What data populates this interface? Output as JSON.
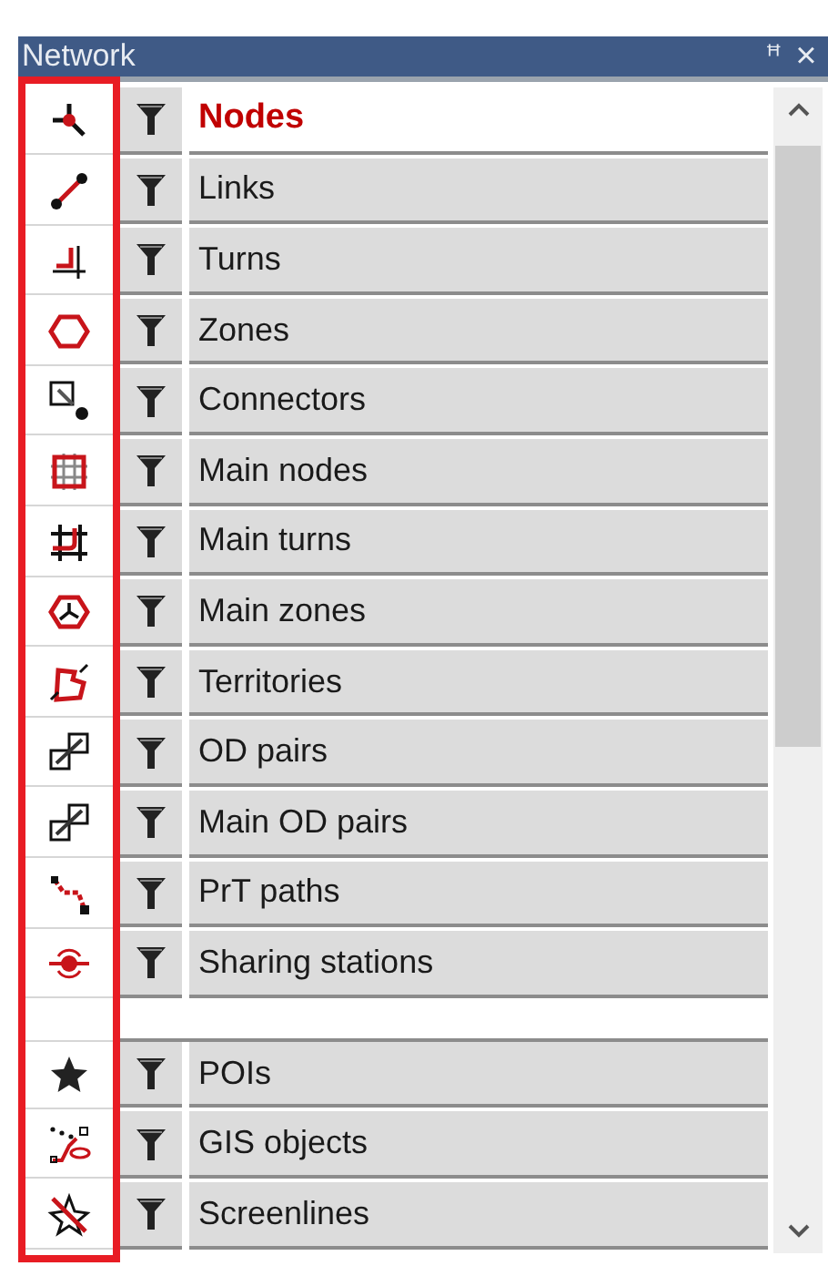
{
  "window": {
    "title": "Network",
    "pin": "ꟸ",
    "close": "×"
  },
  "items": [
    {
      "label": "Nodes",
      "selected": true,
      "kind": "item"
    },
    {
      "label": "Links",
      "selected": false,
      "kind": "item"
    },
    {
      "label": "Turns",
      "selected": false,
      "kind": "item"
    },
    {
      "label": "Zones",
      "selected": false,
      "kind": "item"
    },
    {
      "label": "Connectors",
      "selected": false,
      "kind": "item"
    },
    {
      "label": "Main nodes",
      "selected": false,
      "kind": "item"
    },
    {
      "label": "Main turns",
      "selected": false,
      "kind": "item"
    },
    {
      "label": "Main zones",
      "selected": false,
      "kind": "item"
    },
    {
      "label": "Territories",
      "selected": false,
      "kind": "item"
    },
    {
      "label": "OD pairs",
      "selected": false,
      "kind": "item"
    },
    {
      "label": "Main OD pairs",
      "selected": false,
      "kind": "item"
    },
    {
      "label": "PrT paths",
      "selected": false,
      "kind": "item"
    },
    {
      "label": "Sharing stations",
      "selected": false,
      "kind": "item"
    },
    {
      "kind": "separator"
    },
    {
      "label": "POIs",
      "selected": false,
      "kind": "item"
    },
    {
      "label": "GIS objects",
      "selected": false,
      "kind": "item"
    },
    {
      "label": "Screenlines",
      "selected": false,
      "kind": "item"
    }
  ]
}
